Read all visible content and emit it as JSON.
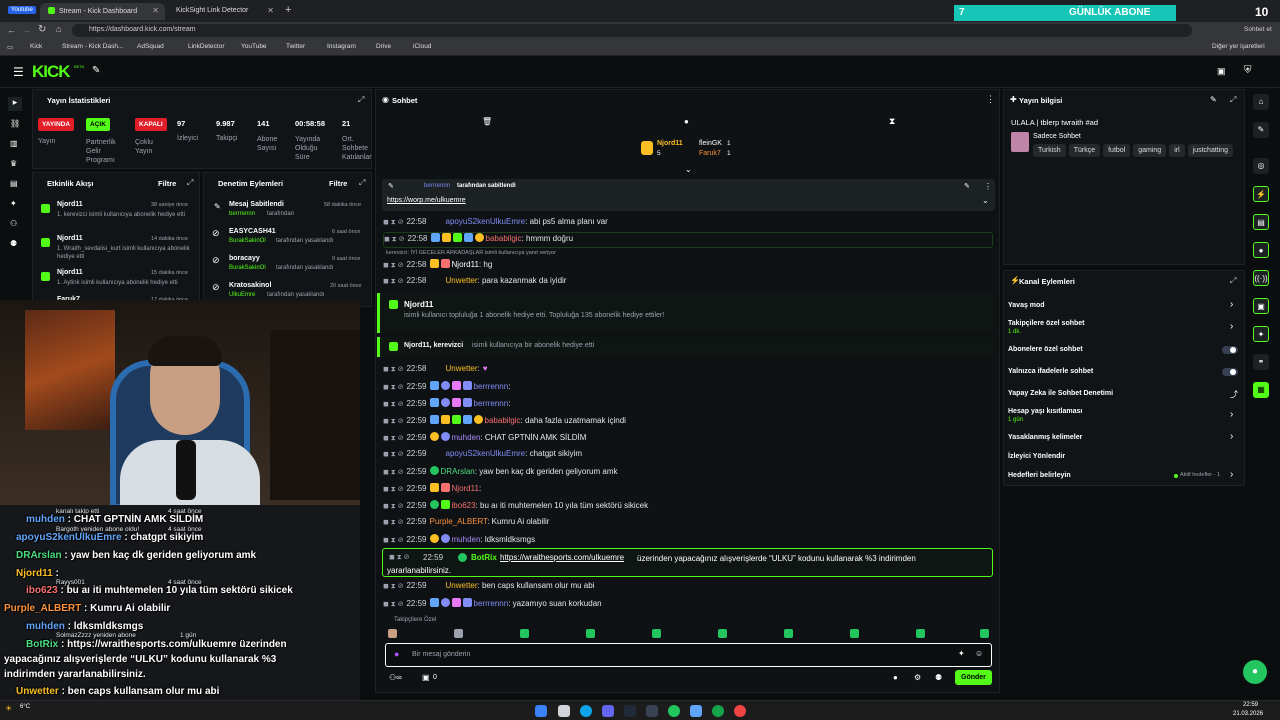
{
  "browser": {
    "tabs": [
      {
        "label": "Stream - Kick Dashboard",
        "active": true
      },
      {
        "label": "KickSight Link Detector",
        "active": false
      }
    ],
    "url": "https://dashboard.kick.com/stream",
    "bookmarks": [
      "Kick",
      "Stream - Kick Dash...",
      "AdSquad",
      "LinkDetector",
      "YouTube",
      "Twitter",
      "Instagram",
      "Drive",
      "iCloud"
    ],
    "other_bookmarks": "Diğer yer işaretleri",
    "overlay_goal": {
      "count": "7",
      "label": "GÜNLÜK ABONE",
      "top": "10"
    },
    "youtube_chip": "Youtube",
    "chat_chip": "Sohbet et"
  },
  "kick": {
    "logo": "KICK",
    "beta": "BETA"
  },
  "stats": {
    "title": "Yayın İstatistikleri",
    "badges": [
      {
        "label": "YAYINDA",
        "caption": "Yayın",
        "color": "#e11d2a"
      },
      {
        "label": "AÇIK",
        "caption": "Partnerlik Gelir Programı",
        "color": "#53fc18"
      },
      {
        "label": "KAPALI",
        "caption": "Çoklu Yayın",
        "color": "#e11d2a"
      }
    ],
    "numbers": [
      {
        "value": "97",
        "caption": "İzleyici"
      },
      {
        "value": "9.987",
        "caption": "Takipçi"
      },
      {
        "value": "141",
        "caption": "Abone Sayısı"
      },
      {
        "value": "00:58:58",
        "caption": "Yayında Olduğu Süre"
      },
      {
        "value": "21",
        "caption": "Ort. Sohbete Katılanlar"
      }
    ]
  },
  "activity": {
    "title": "Etkinlik Akışı",
    "filter": "Filtre",
    "items": [
      {
        "user": "Njord11",
        "text": "1. kerevizci isimli kullanıcıya abonelik hediye etti",
        "time": "38 saniye önce"
      },
      {
        "user": "Njord11",
        "text": "1. Wraith_sevdalisi_kurt isimli kullanıcıya abonelik hediye etti",
        "time": "14 dakika önce"
      },
      {
        "user": "Njord11",
        "text": "1. Aytink isimli kullanıcıya abonelik hediye etti",
        "time": "15 dakika önce"
      },
      {
        "user": "Faruk7",
        "text": "",
        "time": "17 dakika önce"
      }
    ]
  },
  "moderation": {
    "title": "Denetim Eylemleri",
    "filter": "Filtre",
    "items": [
      {
        "title": "Mesaj Sabitlendi",
        "by": "berrrennn",
        "suffix": "tarafından",
        "time": "58 dakika önce"
      },
      {
        "title": "EASYCASH41",
        "by": "BurakSakinOl",
        "suffix": "tarafından yasaklandı",
        "time": "6 saat önce"
      },
      {
        "title": "boracayy",
        "by": "BurakSakinOl",
        "suffix": "tarafından yasaklandı",
        "time": "9 saat önce"
      },
      {
        "title": "Kratosakinol",
        "by": "UlkuEmre",
        "suffix": "tarafından yasaklandı",
        "time": "20 saat önce"
      }
    ]
  },
  "chat": {
    "title": "Sohbet",
    "top_gifter": {
      "name": "Njord11",
      "count": "5"
    },
    "gifter2": {
      "name": "fleinGK",
      "count": "1"
    },
    "gifter3": {
      "name": "Faruk7",
      "count": "1"
    },
    "pinned": {
      "by": "berrrennn",
      "suffix": "tarafından sabitlendi",
      "link": "https://worp.me/ulkuemre"
    },
    "messages": [
      {
        "time": "22:58",
        "user": "apoyuS2kenUlkuEmre",
        "color": "#818cf8",
        "text": ": abi ps5 alma planı var"
      },
      {
        "time": "22:58",
        "user": "bababilgic",
        "color": "#f87171",
        "text": ": hmmm doğru"
      },
      {
        "time": "22:58",
        "user": "Njord11",
        "color": "#fbbf24",
        "text": ": hg"
      },
      {
        "time": "22:58",
        "user": "Unwetter",
        "color": "#fbbf24",
        "text": ": para kazanmak da iyidir"
      },
      {
        "time": "22:58",
        "user": "Unwetter",
        "color": "#fbbf24",
        "text": ":"
      },
      {
        "time": "22:59",
        "user": "berrrennn",
        "color": "#818cf8",
        "text": ":"
      },
      {
        "time": "22:59",
        "user": "berrrennn",
        "color": "#818cf8",
        "text": ":"
      },
      {
        "time": "22:59",
        "user": "bababilgic",
        "color": "#f87171",
        "text": ": daha fazla uzatmamak içindi"
      },
      {
        "time": "22:59",
        "user": "muhden",
        "color": "#a78bfa",
        "text": ": CHAT GPTNİN AMK SİLDİM"
      },
      {
        "time": "22:59",
        "user": "apoyuS2kenUlkuEmre",
        "color": "#818cf8",
        "text": ": chatgpt sikiyim"
      },
      {
        "time": "22:59",
        "user": "DRArslan",
        "color": "#4ade80",
        "text": ": yaw ben kaç dk geriden geliyorum amk"
      },
      {
        "time": "22:59",
        "user": "Njord11",
        "color": "#fbbf24",
        "text": ":"
      },
      {
        "time": "22:59",
        "user": "ibo623",
        "color": "#f87171",
        "text": ": bu aı iti muhtemelen 10 yıla tüm sektörü sikicek"
      },
      {
        "time": "22:59",
        "user": "Purple_ALBERT",
        "color": "#fb923c",
        "text": ": Kumru Ai olabilir"
      },
      {
        "time": "22:59",
        "user": "muhden",
        "color": "#a78bfa",
        "text": ": ldksmldksmgs"
      },
      {
        "time": "22:59",
        "user": "Unwetter",
        "color": "#fbbf24",
        "text": ": ben caps kullansam olur mu abi"
      },
      {
        "time": "22:59",
        "user": "berrrennn",
        "color": "#818cf8",
        "text": ": yazamıyo suan korkudan"
      }
    ],
    "deleted_note": "kerevizci: İYİ GECELER ARKADAŞLAR isimli kullanıcıya yanıt veriyor",
    "gift1": {
      "user": "Njord11",
      "text": "isimli kullanıcı topluluğa 1 abonelik hediye etti. Topluluğa 135 abonelik hediye ettiler!"
    },
    "gift2": {
      "user": "Njord11, kerevizci",
      "text": "isimli kullanıcıya bir abonelik hediye etti"
    },
    "bot": {
      "time": "22:59",
      "user": "BotRix",
      "link": "https://wraithesports.com/ulkuemre",
      "text": "üzerinden yapacağınız alışverişlerde “ULKU” kodunu kullanarak %3 indirimden yararlanabilirsiniz."
    },
    "followers_only": "Takipçilere Özel",
    "input_placeholder": "Bir mesaj gönderin",
    "send": "Gönder",
    "footer_count": "0"
  },
  "stream_info": {
    "title": "Yayın bilgisi",
    "stream_title": "ULALA | tblerp twraith #ad",
    "subtitle": "Sadece Sohbet",
    "tags": [
      "Turkish",
      "Türkçe",
      "futbol",
      "gaming",
      "irl",
      "justchatting"
    ]
  },
  "channel_actions": {
    "title": "Kanal Eylemleri",
    "items": [
      {
        "label": "Yavaş mod",
        "sub": "",
        "control": "chevron"
      },
      {
        "label": "Takipçilere özel sohbet",
        "sub": "1 dk.",
        "control": "chevron"
      },
      {
        "label": "Abonelere özel sohbet",
        "sub": "",
        "control": "toggle"
      },
      {
        "label": "Yalnızca ifadelerle sohbet",
        "sub": "",
        "control": "toggle"
      },
      {
        "label": "Yapay Zeka ile Sohbet Denetimi",
        "sub": "",
        "control": "link"
      },
      {
        "label": "Hesap yaşı kısıtlaması",
        "sub": "1 gün",
        "control": "chevron"
      },
      {
        "label": "Yasaklanmış kelimeler",
        "sub": "",
        "control": "chevron"
      },
      {
        "label": "İzleyici Yönlendir",
        "sub": "",
        "control": "none"
      },
      {
        "label": "Hedefleri belirleyin",
        "sub": "",
        "control": "chevron"
      }
    ],
    "goal_status": "Aktif hedefler - 1"
  },
  "overlay": {
    "lines": [
      {
        "user": "muhden",
        "color": "#60a5fa",
        "text": " : CHAT GPTNİN AMK SİLDİM"
      },
      {
        "user": "apoyuS2kenUlkuEmre",
        "color": "#60a5fa",
        "text": " : chatgpt sikiyim"
      },
      {
        "user": "DRArslan",
        "color": "#4ade80",
        "text": " : yaw ben kaç dk geriden geliyorum amk"
      },
      {
        "user": "Njord11",
        "color": "#fbbf24",
        "text": " :"
      },
      {
        "user": "ibo623",
        "color": "#f87171",
        "text": " : bu aı iti muhtemelen 10 yıla tüm sektörü sikicek"
      },
      {
        "user": "Purple_ALBERT",
        "color": "#fb923c",
        "text": " : Kumru Ai olabilir"
      },
      {
        "user": "muhden",
        "color": "#60a5fa",
        "text": " : ldksmldksmgs"
      },
      {
        "user": "BotRix",
        "color": "#4ade80",
        "text": " : https://wraithesports.com/ulkuemre üzerinden"
      },
      {
        "user": "",
        "color": "#fff",
        "text": "yapacağınız alışverişlerde “ULKU” kodunu kullanarak %3"
      },
      {
        "user": "",
        "color": "#fff",
        "text": "indirimden yararlanabilirsiniz."
      },
      {
        "user": "Unwetter",
        "color": "#fbbf24",
        "text": " : ben caps kullansam olur mu abi"
      },
      {
        "user": "berrrennn",
        "color": "#60a5fa",
        "text": " : yazamıyo suan korkudan"
      }
    ],
    "alerts": [
      {
        "text": "kanalı takip etti",
        "time": "4 saat önce"
      },
      {
        "text": "Bargoth yeniden abone oldu!",
        "time": "4 saat önce"
      },
      {
        "text": "Rayys001",
        "time": "4 saat önce"
      },
      {
        "text": "SolmazZzzz yeniden abone",
        "time": "1 gün"
      }
    ]
  },
  "taskbar": {
    "weather": "6°C",
    "time": "22:59",
    "date": "21.03.2026"
  }
}
